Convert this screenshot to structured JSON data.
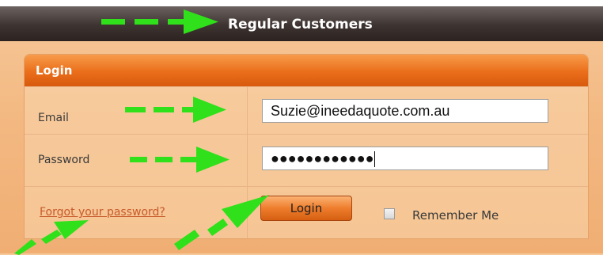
{
  "header": {
    "title": "Regular Customers"
  },
  "panel": {
    "title": "Login"
  },
  "form": {
    "email_label": "Email",
    "email_value": "Suzie@ineedaquote.com.au",
    "password_label": "Password",
    "password_masked": "●●●●●●●●●●●●",
    "forgot_link": "Forgot your password?",
    "login_button": "Login",
    "remember_label": "Remember Me",
    "remember_checked": false
  },
  "colors": {
    "arrow": "#2fe01a",
    "panel_header": "#ea6e1a",
    "header_bar": "#3d3331",
    "link": "#c85a2a"
  },
  "annotations": {
    "arrows": [
      "header",
      "email",
      "password",
      "forgot-link",
      "login-button"
    ]
  }
}
